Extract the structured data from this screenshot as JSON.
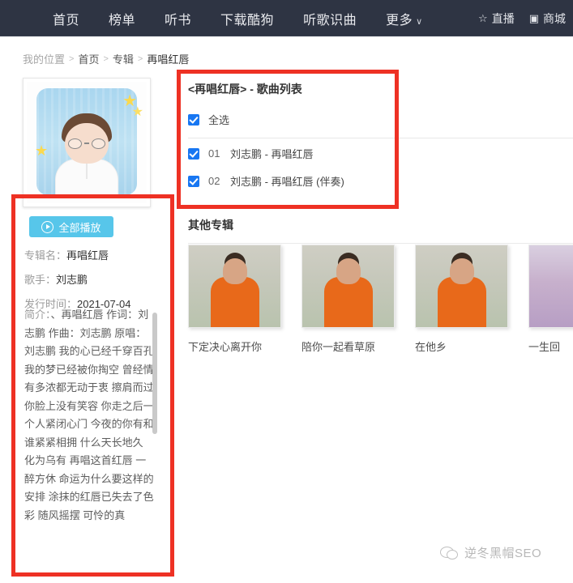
{
  "nav": {
    "items": [
      {
        "label": "首页",
        "chevron": false
      },
      {
        "label": "榜单",
        "chevron": false
      },
      {
        "label": "听书",
        "chevron": false
      },
      {
        "label": "下载酷狗",
        "chevron": false
      },
      {
        "label": "听歌识曲",
        "chevron": false
      },
      {
        "label": "更多",
        "chevron": true
      }
    ],
    "chevron_glyph": "∨",
    "right_items": [
      {
        "icon": "star-icon",
        "glyph": "☆",
        "label": "直播"
      },
      {
        "icon": "shop-icon",
        "glyph": "▣",
        "label": "商城"
      }
    ]
  },
  "breadcrumb": {
    "label": "我的位置",
    "sep": ">",
    "items": [
      "首页",
      "专辑"
    ],
    "current": "再唱红唇"
  },
  "album": {
    "cover_alt": "album-cover-cartoon-avatar",
    "play_all_label": "全部播放",
    "meta": [
      {
        "key": "专辑名：",
        "value": "再唱红唇"
      },
      {
        "key": "歌手：",
        "value": "刘志鹏"
      },
      {
        "key": "发行时间：",
        "value": "2021-07-04"
      }
    ],
    "desc_key": "简介：",
    "desc_text": "、再唱红唇 作词：刘志鹏 作曲：刘志鹏 原唱：刘志鹏 我的心已经千穿百孔 我的梦已经被你掏空 曾经情有多浓都无动于衷 擦肩而过 你脸上没有笑容 你走之后一个人紧闭心门 今夜的你有和谁紧紧相拥 什么天长地久 化为乌有 再唱这首红唇 一醉方休 命运为什么要这样的安排 涂抹的红唇已失去了色彩 随风摇摆 可怜的真"
  },
  "songlist": {
    "title": "<再唱红唇> - 歌曲列表",
    "select_all_label": "全选",
    "select_all_checked": true,
    "songs": [
      {
        "num": "01",
        "name": "刘志鹏 - 再唱红唇",
        "checked": true
      },
      {
        "num": "02",
        "name": "刘志鹏 - 再唱红唇 (伴奏)",
        "checked": true
      }
    ]
  },
  "other_albums": {
    "title": "其他专辑",
    "items": [
      {
        "name": "下定决心离开你",
        "thumb": "orange"
      },
      {
        "name": "陪你一起看草原",
        "thumb": "orange"
      },
      {
        "name": "在他乡",
        "thumb": "orange"
      },
      {
        "name": "一生回",
        "thumb": "purple"
      }
    ]
  },
  "watermark": {
    "text": "逆冬黑帽SEO",
    "icon": "wechat-icon"
  },
  "colors": {
    "nav_bg": "#2e3443",
    "play_button": "#57c6ea",
    "checkbox": "#1877f2",
    "annotation_red": "#ee3124"
  }
}
